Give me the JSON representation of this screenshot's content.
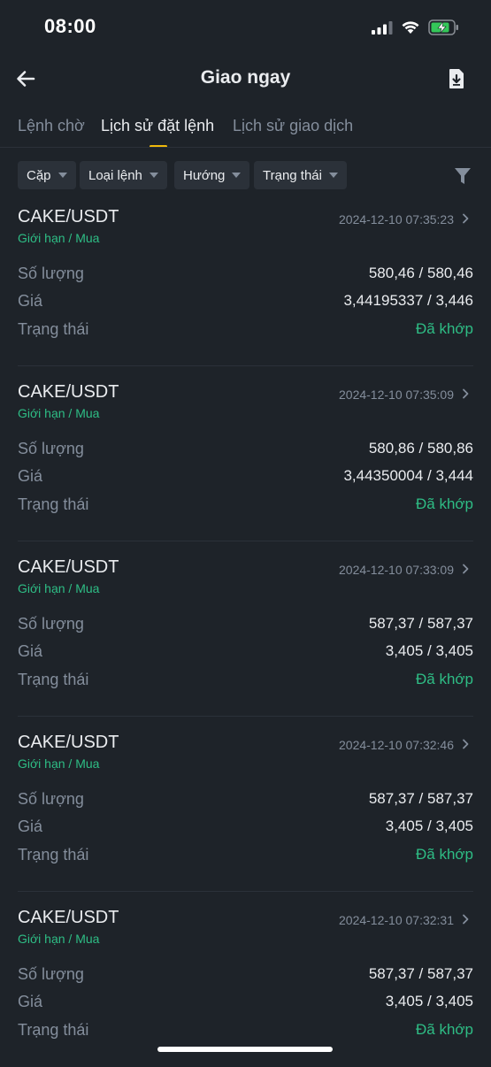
{
  "status_bar": {
    "time": "08:00"
  },
  "header": {
    "title": "Giao ngay"
  },
  "tabs": [
    {
      "label": "Lệnh chờ"
    },
    {
      "label": "Lịch sử đặt lệnh"
    },
    {
      "label": "Lịch sử giao dịch"
    }
  ],
  "filters": [
    {
      "label": "Cặp"
    },
    {
      "label": "Loại lệnh"
    },
    {
      "label": "Hướng"
    },
    {
      "label": "Trạng thái"
    }
  ],
  "row_labels": {
    "amount": "Số lượng",
    "price": "Giá",
    "status": "Trạng thái"
  },
  "orders": [
    {
      "pair": "CAKE/USDT",
      "type": "Giới hạn / Mua",
      "time": "2024-12-10 07:35:23",
      "amount": "580,46 / 580,46",
      "price": "3,44195337 / 3,446",
      "status": "Đã khớp"
    },
    {
      "pair": "CAKE/USDT",
      "type": "Giới hạn / Mua",
      "time": "2024-12-10 07:35:09",
      "amount": "580,86 / 580,86",
      "price": "3,44350004 / 3,444",
      "status": "Đã khớp"
    },
    {
      "pair": "CAKE/USDT",
      "type": "Giới hạn / Mua",
      "time": "2024-12-10 07:33:09",
      "amount": "587,37 / 587,37",
      "price": "3,405 / 3,405",
      "status": "Đã khớp"
    },
    {
      "pair": "CAKE/USDT",
      "type": "Giới hạn / Mua",
      "time": "2024-12-10 07:32:46",
      "amount": "587,37 / 587,37",
      "price": "3,405 / 3,405",
      "status": "Đã khớp"
    },
    {
      "pair": "CAKE/USDT",
      "type": "Giới hạn / Mua",
      "time": "2024-12-10 07:32:31",
      "amount": "587,37 / 587,37",
      "price": "3,405 / 3,405",
      "status": "Đã khớp"
    }
  ],
  "colors": {
    "background": "#1e2329",
    "accent": "#f0b90b",
    "buy_green": "#2ebd85",
    "muted": "#848e9c",
    "chip_bg": "#2b3139"
  },
  "icons": [
    "back-arrow-icon",
    "export-download-icon",
    "filter-funnel-icon",
    "chevron-right-icon",
    "signal-icon",
    "wifi-icon",
    "battery-charging-icon"
  ]
}
